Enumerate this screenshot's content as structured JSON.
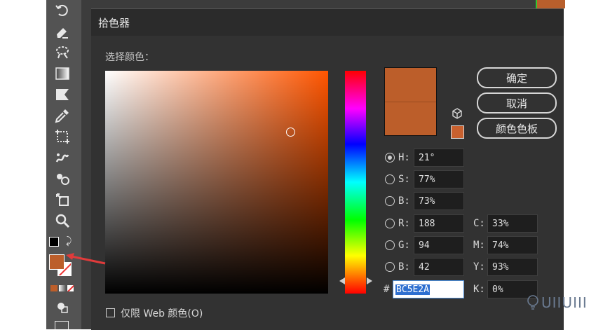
{
  "dialog": {
    "title": "拾色器",
    "select_label": "选择颜色：",
    "buttons": {
      "ok": "确定",
      "cancel": "取消",
      "swatches": "颜色色板"
    },
    "fields": {
      "h": {
        "label": "H:",
        "value": "21°"
      },
      "s": {
        "label": "S:",
        "value": "77%"
      },
      "b": {
        "label": "B:",
        "value": "73%"
      },
      "r": {
        "label": "R:",
        "value": "188"
      },
      "g": {
        "label": "G:",
        "value": "94"
      },
      "b2": {
        "label": "B:",
        "value": "42"
      },
      "hex_label": "#",
      "hex": "BC5E2A",
      "c": {
        "label": "C:",
        "value": "33%"
      },
      "m": {
        "label": "M:",
        "value": "74%"
      },
      "y": {
        "label": "Y:",
        "value": "93%"
      },
      "k": {
        "label": "K:",
        "value": "0%"
      }
    },
    "web_only_label": "仅限 Web 颜色(O)",
    "colors": {
      "current": "#bc5e2a",
      "websafe": "#cc6633",
      "arrow": "#e03b3b"
    }
  },
  "toolbar": {
    "icons": [
      "undo-rotate-icon",
      "eraser-icon",
      "lasso-icon",
      "gradient-icon",
      "shape-icon",
      "eyedropper-icon",
      "crop-icon",
      "puppet-warp-icon",
      "blend-icon",
      "resize-icon",
      "zoom-icon"
    ],
    "fill_color": "#bc5e2a"
  },
  "watermark": "UIIUIII"
}
